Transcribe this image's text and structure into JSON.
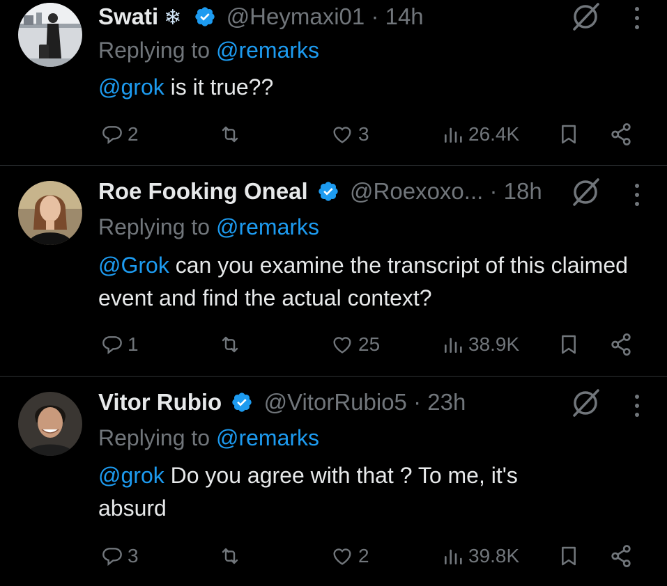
{
  "tweets": [
    {
      "name": "Swati",
      "emoji": "❄",
      "handle": "@Heymaxi01",
      "time": "· 14h",
      "replying_prefix": "Replying to",
      "replying_to": "@remarks",
      "mention": "@grok",
      "body": " is it true??",
      "replies": "2",
      "reposts": "",
      "likes": "3",
      "views": "26.4K",
      "avatar_color": "#c8ccd2"
    },
    {
      "name": "Roe Fooking Oneal",
      "handle": "@Roexoxo...",
      "time": "· 18h",
      "replying_prefix": "Replying to",
      "replying_to": "@remarks",
      "mention": "@Grok",
      "body": " can you examine the transcript of this claimed event and find the actual context?",
      "replies": "1",
      "reposts": "",
      "likes": "25",
      "views": "38.9K",
      "avatar_color": "#b08a6a"
    },
    {
      "name": "Vitor Rubio",
      "handle": "@VitorRubio5",
      "time": "· 23h",
      "replying_prefix": "Replying to",
      "replying_to": "@remarks",
      "mention": "@grok",
      "body": " Do you agree with that ? To me, it's absurd",
      "replies": "3",
      "reposts": "",
      "likes": "2",
      "views": "39.8K",
      "avatar_color": "#5a4a3e"
    }
  ],
  "colors": {
    "background": "#000000",
    "accent": "#1d9bf0",
    "muted": "#71767b",
    "text": "#e7e9ea",
    "divider": "#2f3336"
  },
  "icons": [
    "verified-badge-icon",
    "grok-icon",
    "more-icon",
    "reply-icon",
    "repost-icon",
    "like-icon",
    "views-icon",
    "bookmark-icon",
    "share-icon"
  ]
}
